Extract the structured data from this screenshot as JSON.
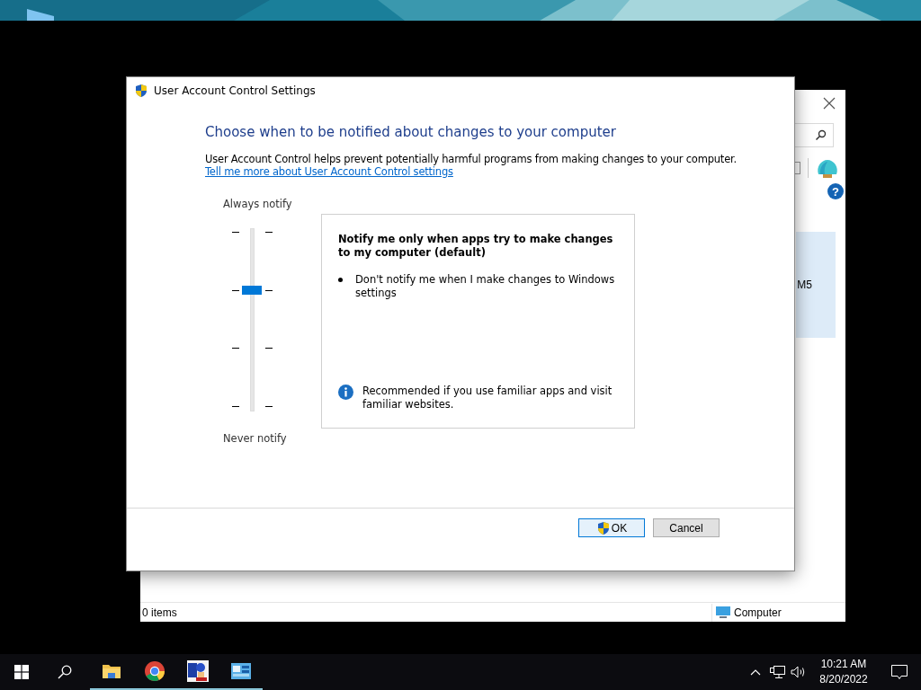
{
  "background_window": {
    "help_glyph": "?",
    "partial_text": "M5",
    "status_bar": {
      "items": "0 items",
      "location": "Computer"
    }
  },
  "dialog": {
    "title": "User Account Control Settings",
    "heading": "Choose when to be notified about changes to your computer",
    "description": "User Account Control helps prevent potentially harmful programs from making changes to your computer.",
    "link": "Tell me more about User Account Control settings",
    "slider": {
      "top_label": "Always notify",
      "bottom_label": "Never notify",
      "level": 0.6667
    },
    "detail": {
      "title": "Notify me only when apps try to make changes to my computer (default)",
      "bullets": [
        "Don't notify me when I make changes to Windows settings"
      ],
      "note": "Recommended if you use familiar apps and visit familiar websites."
    },
    "buttons": [
      {
        "label": "OK",
        "kind": "elevated",
        "focused": true
      },
      {
        "label": "Cancel",
        "kind": "plain",
        "focused": false
      }
    ]
  },
  "taskbar": {
    "apps": [
      {
        "kind": "explorer",
        "running": true
      },
      {
        "kind": "browser",
        "running": true
      },
      {
        "kind": "game",
        "running": true
      },
      {
        "kind": "control",
        "running": true
      }
    ],
    "clock": {
      "time": "10:21 AM",
      "date": "8/20/2022"
    }
  }
}
